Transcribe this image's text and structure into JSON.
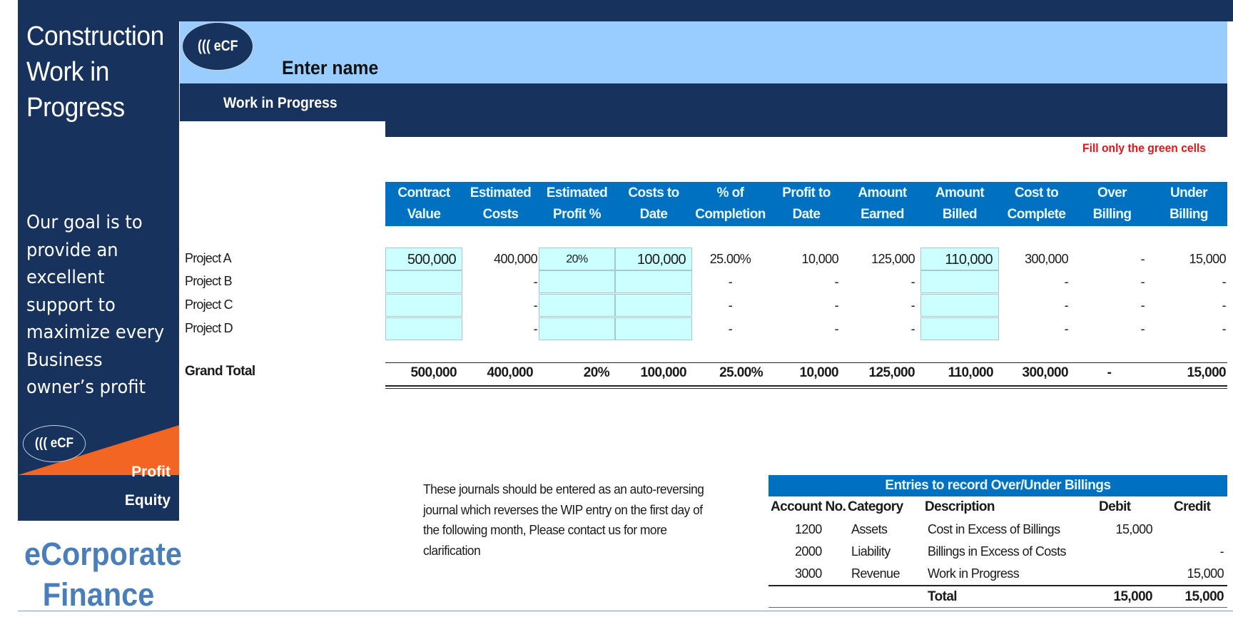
{
  "sidebar": {
    "title": "Construction Work in Progress",
    "goal_text": "Our goal is to provide an excellent support to maximize every Business owner’s profit",
    "logo_small": "((( eCF",
    "logo_profit": "Profit",
    "logo_equity": "Equity",
    "brand_line1": "eCorporate",
    "brand_line2": "Finance"
  },
  "colors": {
    "navy": "#17325c",
    "light_blue": "#99ccff",
    "header_blue": "#0070c0",
    "input_cell": "#ccffff",
    "accent_orange": "#f26522",
    "note_red": "#e0161b",
    "brand_blue": "#4a7ebb"
  },
  "header": {
    "logo": "((( eCF",
    "company_name": "Enter name",
    "section_title": "Work in Progress",
    "fill_note": "Fill only the green cells"
  },
  "table": {
    "columns": [
      "Contract\nValue",
      "Estimated\nCosts",
      "Estimated\nProfit %",
      "Costs to\nDate",
      "% of\nCompletion",
      "Profit to\nDate",
      "Amount\nEarned",
      "Amount\nBilled",
      "Cost to\nComplete",
      "Over\nBilling",
      "Under\nBilling"
    ],
    "rows": [
      {
        "label": "Project A",
        "values": [
          "500,000",
          "400,000",
          "20%",
          "100,000",
          "25.00%",
          "10,000",
          "125,000",
          "110,000",
          "300,000",
          "-",
          "15,000"
        ]
      },
      {
        "label": "Project B",
        "values": [
          "",
          "-",
          "",
          "",
          "-",
          "-",
          "-",
          "",
          "-",
          "-",
          "-"
        ]
      },
      {
        "label": "Project C",
        "values": [
          "",
          "-",
          "",
          "",
          "-",
          "-",
          "-",
          "",
          "-",
          "-",
          "-"
        ]
      },
      {
        "label": "Project D",
        "values": [
          "",
          "-",
          "",
          "",
          "-",
          "-",
          "-",
          "",
          "-",
          "-",
          "-"
        ]
      }
    ],
    "total": {
      "label": "Grand Total",
      "values": [
        "500,000",
        "400,000",
        "20%",
        "100,000",
        "25.00%",
        "10,000",
        "125,000",
        "110,000",
        "300,000",
        "-",
        "15,000"
      ]
    }
  },
  "journal_note": "These journals should be entered as an auto-reversing journal which reverses the WIP entry on the first day of the following month, Please contact us for more clarification",
  "entries": {
    "title": "Entries to record Over/Under Billings",
    "headers": [
      "Account No.",
      "Category",
      "Description",
      "Debit",
      "Credit"
    ],
    "rows": [
      {
        "account": "1200",
        "category": "Assets",
        "description": "Cost in Excess of Billings",
        "debit": "15,000",
        "credit": ""
      },
      {
        "account": "2000",
        "category": "Liability",
        "description": "Billings in Excess of Costs",
        "debit": "",
        "credit": "-"
      },
      {
        "account": "3000",
        "category": "Revenue",
        "description": "Work in Progress",
        "debit": "",
        "credit": "15,000"
      }
    ],
    "total": {
      "label": "Total",
      "debit": "15,000",
      "credit": "15,000"
    }
  }
}
